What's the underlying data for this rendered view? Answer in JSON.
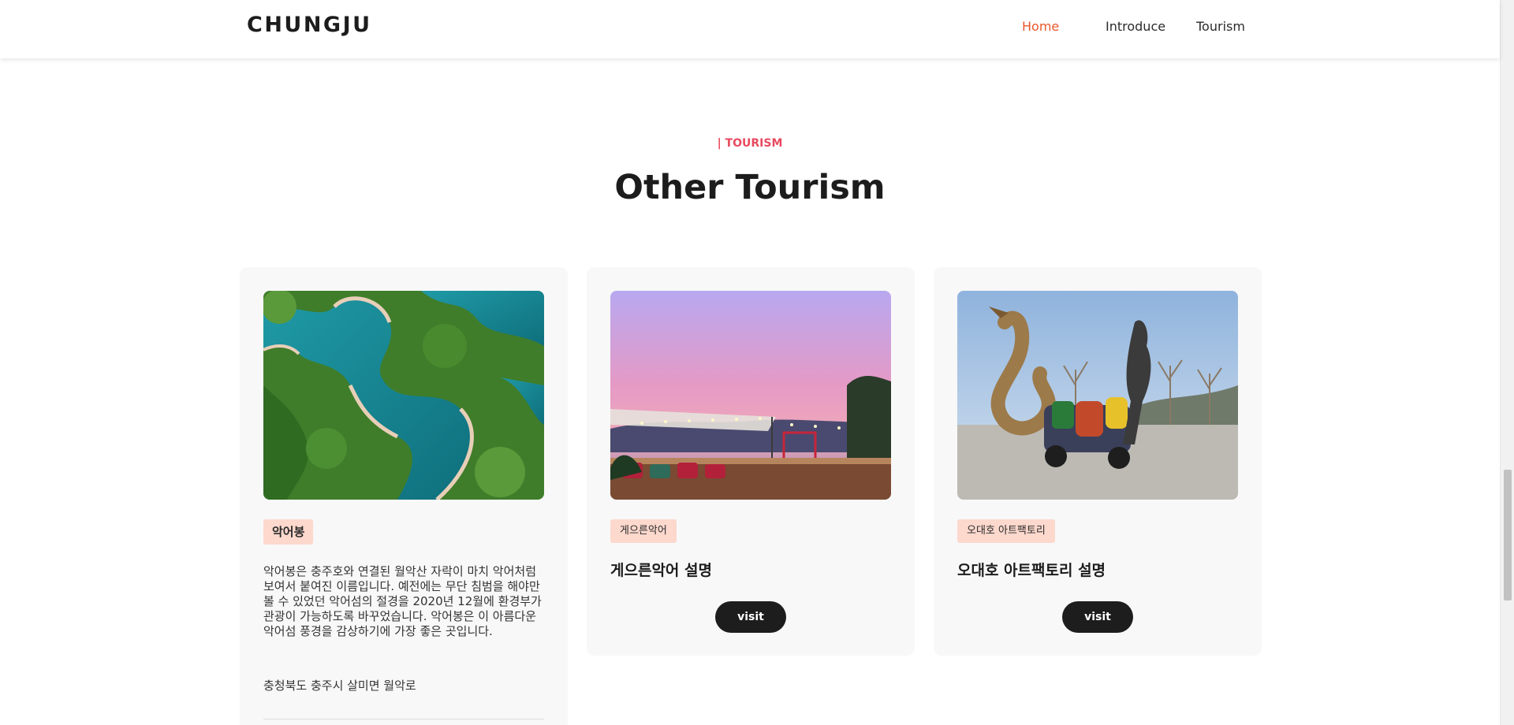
{
  "header": {
    "logo": "CHUNGJU",
    "nav": [
      {
        "label": "Home",
        "active": true
      },
      {
        "label": "Introduce",
        "active": false
      },
      {
        "label": "Tourism",
        "active": false
      }
    ]
  },
  "section": {
    "eyebrow": "| TOURISM",
    "title": "Other Tourism"
  },
  "cards": [
    {
      "image_icon": "aerial-lake-photo",
      "tag": "악어봉",
      "description": "악어봉은 충주호와 연결된 월악산 자락이 마치 악어처럼 보여서 붙여진 이름입니다. 예전에는 무단 침범을 해야만 볼 수 있었던 악어섬의 절경을 2020년 12월에 환경부가 관광이 가능하도록 바꾸었습니다. 악어봉은 이 아름다운 악어섬 풍경을 감상하기에 가장 좋은 곳입니다.",
      "address": "충청북도 충주시 살미면 월악로"
    },
    {
      "image_icon": "sunset-terrace-photo",
      "tag": "게으른악어",
      "title": "게으른악어 설명",
      "button": "visit"
    },
    {
      "image_icon": "dragon-sculpture-photo",
      "tag": "오대호 아트팩토리",
      "title": "오대호 아트팩토리 설명",
      "button": "visit"
    }
  ],
  "colors": {
    "accent": "#e9582c",
    "eyebrow": "#e84a5f",
    "tag_bg": "#fcd8cd",
    "card_bg": "#f8f8f8",
    "button_bg": "#1d1d1d"
  }
}
